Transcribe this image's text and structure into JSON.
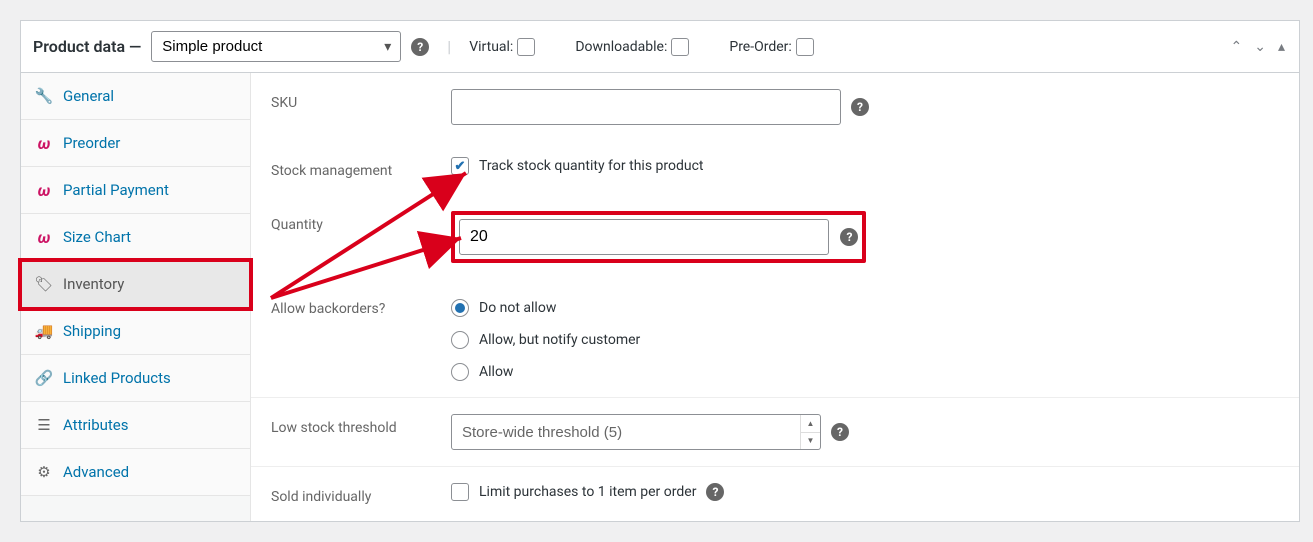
{
  "header": {
    "title": "Product data —",
    "product_type": "Simple product",
    "virtual_label": "Virtual:",
    "downloadable_label": "Downloadable:",
    "preorder_label": "Pre-Order:"
  },
  "tabs": [
    {
      "key": "general",
      "label": "General",
      "icon": "wrench-icon"
    },
    {
      "key": "preorder",
      "label": "Preorder",
      "icon": "brand-icon",
      "brand": true
    },
    {
      "key": "partial",
      "label": "Partial Payment",
      "icon": "brand-icon",
      "brand": true
    },
    {
      "key": "sizechart",
      "label": "Size Chart",
      "icon": "brand-icon",
      "brand": true
    },
    {
      "key": "inventory",
      "label": "Inventory",
      "icon": "tag-icon",
      "active": true
    },
    {
      "key": "shipping",
      "label": "Shipping",
      "icon": "truck-icon"
    },
    {
      "key": "linked",
      "label": "Linked Products",
      "icon": "link-icon"
    },
    {
      "key": "attributes",
      "label": "Attributes",
      "icon": "list-icon"
    },
    {
      "key": "advanced",
      "label": "Advanced",
      "icon": "gear-icon"
    }
  ],
  "fields": {
    "sku_label": "SKU",
    "sku_value": "",
    "stock_mgmt_label": "Stock management",
    "stock_mgmt_text": "Track stock quantity for this product",
    "stock_mgmt_checked": true,
    "quantity_label": "Quantity",
    "quantity_value": "20",
    "backorders_label": "Allow backorders?",
    "backorders": {
      "options": [
        "Do not allow",
        "Allow, but notify customer",
        "Allow"
      ],
      "selected": 0
    },
    "low_stock_label": "Low stock threshold",
    "low_stock_value": "Store-wide threshold (5)",
    "sold_indiv_label": "Sold individually",
    "sold_indiv_text": "Limit purchases to 1 item per order"
  }
}
